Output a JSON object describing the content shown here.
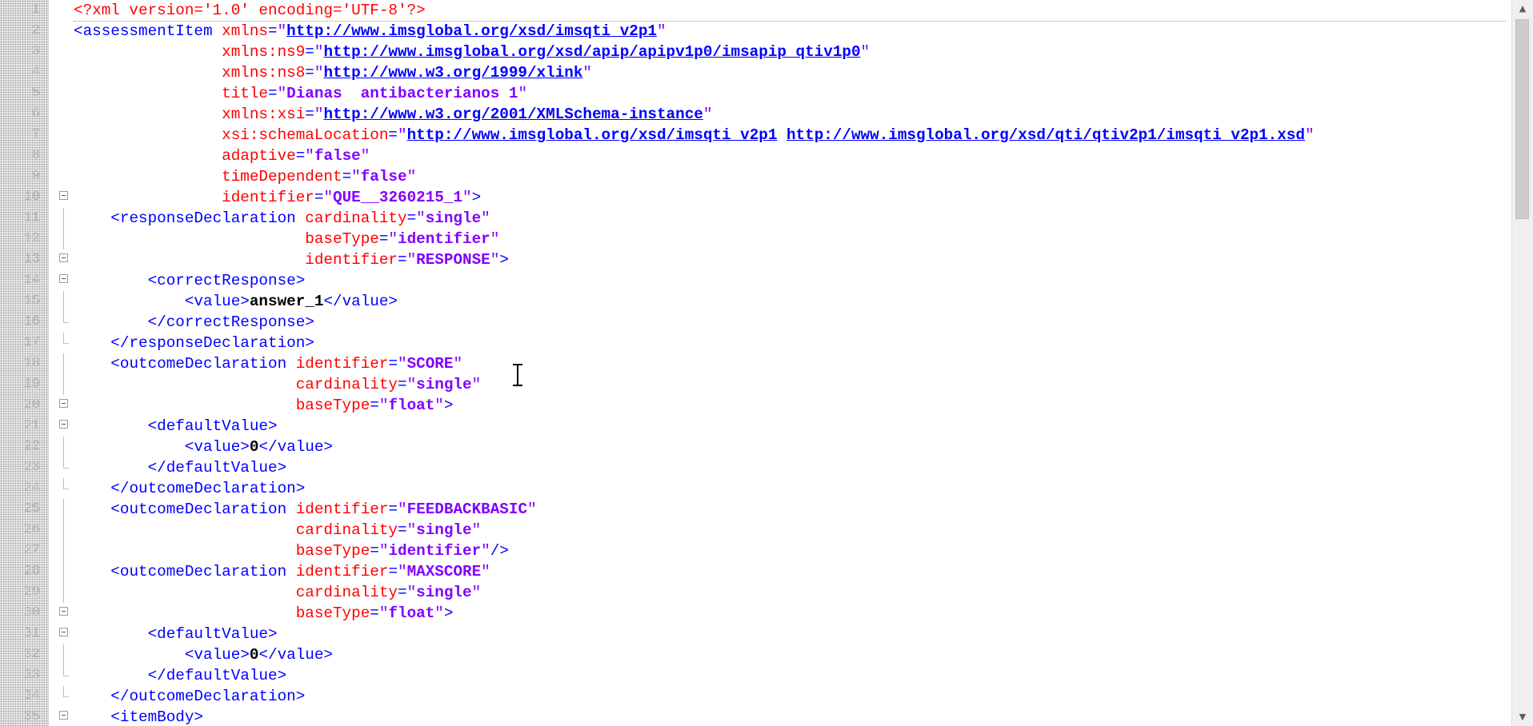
{
  "editor": {
    "lines": [
      {
        "n": "1",
        "tokens": [
          {
            "t": "pi",
            "s": "<?xml version='1.0' encoding='UTF-8'?>"
          }
        ]
      },
      {
        "n": "2",
        "tokens": [
          {
            "t": "tag",
            "s": "<assessmentItem "
          },
          {
            "t": "attr",
            "s": "xmlns"
          },
          {
            "t": "tag",
            "s": "="
          },
          {
            "t": "q",
            "s": "\""
          },
          {
            "t": "url",
            "s": "http://www.imsglobal.org/xsd/imsqti_v2p1"
          },
          {
            "t": "q",
            "s": "\""
          }
        ]
      },
      {
        "n": "3",
        "tokens": [
          {
            "t": "plain",
            "s": "                "
          },
          {
            "t": "attr",
            "s": "xmlns:ns9"
          },
          {
            "t": "tag",
            "s": "="
          },
          {
            "t": "q",
            "s": "\""
          },
          {
            "t": "url",
            "s": "http://www.imsglobal.org/xsd/apip/apipv1p0/imsapip_qtiv1p0"
          },
          {
            "t": "q",
            "s": "\""
          }
        ]
      },
      {
        "n": "4",
        "tokens": [
          {
            "t": "plain",
            "s": "                "
          },
          {
            "t": "attr",
            "s": "xmlns:ns8"
          },
          {
            "t": "tag",
            "s": "="
          },
          {
            "t": "q",
            "s": "\""
          },
          {
            "t": "url",
            "s": "http://www.w3.org/1999/xlink"
          },
          {
            "t": "q",
            "s": "\""
          }
        ]
      },
      {
        "n": "5",
        "tokens": [
          {
            "t": "plain",
            "s": "                "
          },
          {
            "t": "attr",
            "s": "title"
          },
          {
            "t": "tag",
            "s": "="
          },
          {
            "t": "q",
            "s": "\""
          },
          {
            "t": "val",
            "s": "Dianas  antibacterianos 1"
          },
          {
            "t": "q",
            "s": "\""
          }
        ]
      },
      {
        "n": "6",
        "tokens": [
          {
            "t": "plain",
            "s": "                "
          },
          {
            "t": "attr",
            "s": "xmlns:xsi"
          },
          {
            "t": "tag",
            "s": "="
          },
          {
            "t": "q",
            "s": "\""
          },
          {
            "t": "url",
            "s": "http://www.w3.org/2001/XMLSchema-instance"
          },
          {
            "t": "q",
            "s": "\""
          }
        ]
      },
      {
        "n": "7",
        "tokens": [
          {
            "t": "plain",
            "s": "                "
          },
          {
            "t": "attr",
            "s": "xsi:schemaLocation"
          },
          {
            "t": "tag",
            "s": "="
          },
          {
            "t": "q",
            "s": "\""
          },
          {
            "t": "url",
            "s": "http://www.imsglobal.org/xsd/imsqti_v2p1"
          },
          {
            "t": "plain",
            "s": " "
          },
          {
            "t": "url",
            "s": "http://www.imsglobal.org/xsd/qti/qtiv2p1/imsqti_v2p1.xsd"
          },
          {
            "t": "q",
            "s": "\""
          }
        ]
      },
      {
        "n": "8",
        "tokens": [
          {
            "t": "plain",
            "s": "                "
          },
          {
            "t": "attr",
            "s": "adaptive"
          },
          {
            "t": "tag",
            "s": "="
          },
          {
            "t": "q",
            "s": "\""
          },
          {
            "t": "val",
            "s": "false"
          },
          {
            "t": "q",
            "s": "\""
          }
        ]
      },
      {
        "n": "9",
        "tokens": [
          {
            "t": "plain",
            "s": "                "
          },
          {
            "t": "attr",
            "s": "timeDependent"
          },
          {
            "t": "tag",
            "s": "="
          },
          {
            "t": "q",
            "s": "\""
          },
          {
            "t": "val",
            "s": "false"
          },
          {
            "t": "q",
            "s": "\""
          }
        ]
      },
      {
        "n": "10",
        "tokens": [
          {
            "t": "plain",
            "s": "                "
          },
          {
            "t": "attr",
            "s": "identifier"
          },
          {
            "t": "tag",
            "s": "="
          },
          {
            "t": "q",
            "s": "\""
          },
          {
            "t": "val",
            "s": "QUE__3260215_1"
          },
          {
            "t": "q",
            "s": "\""
          },
          {
            "t": "tag",
            "s": ">"
          }
        ]
      },
      {
        "n": "11",
        "tokens": [
          {
            "t": "plain",
            "s": "    "
          },
          {
            "t": "tag",
            "s": "<responseDeclaration "
          },
          {
            "t": "attr",
            "s": "cardinality"
          },
          {
            "t": "tag",
            "s": "="
          },
          {
            "t": "q",
            "s": "\""
          },
          {
            "t": "val",
            "s": "single"
          },
          {
            "t": "q",
            "s": "\""
          }
        ]
      },
      {
        "n": "12",
        "tokens": [
          {
            "t": "plain",
            "s": "                         "
          },
          {
            "t": "attr",
            "s": "baseType"
          },
          {
            "t": "tag",
            "s": "="
          },
          {
            "t": "q",
            "s": "\""
          },
          {
            "t": "val",
            "s": "identifier"
          },
          {
            "t": "q",
            "s": "\""
          }
        ]
      },
      {
        "n": "13",
        "tokens": [
          {
            "t": "plain",
            "s": "                         "
          },
          {
            "t": "attr",
            "s": "identifier"
          },
          {
            "t": "tag",
            "s": "="
          },
          {
            "t": "q",
            "s": "\""
          },
          {
            "t": "val",
            "s": "RESPONSE"
          },
          {
            "t": "q",
            "s": "\""
          },
          {
            "t": "tag",
            "s": ">"
          }
        ]
      },
      {
        "n": "14",
        "tokens": [
          {
            "t": "plain",
            "s": "        "
          },
          {
            "t": "tag",
            "s": "<correctResponse>"
          }
        ]
      },
      {
        "n": "15",
        "tokens": [
          {
            "t": "plain",
            "s": "            "
          },
          {
            "t": "tag",
            "s": "<value>"
          },
          {
            "t": "text",
            "s": "answer_1"
          },
          {
            "t": "tag",
            "s": "</value>"
          }
        ]
      },
      {
        "n": "16",
        "tokens": [
          {
            "t": "plain",
            "s": "        "
          },
          {
            "t": "tag",
            "s": "</correctResponse>"
          }
        ]
      },
      {
        "n": "17",
        "tokens": [
          {
            "t": "plain",
            "s": "    "
          },
          {
            "t": "tag",
            "s": "</responseDeclaration>"
          }
        ]
      },
      {
        "n": "18",
        "tokens": [
          {
            "t": "plain",
            "s": "    "
          },
          {
            "t": "tag",
            "s": "<outcomeDeclaration "
          },
          {
            "t": "attr",
            "s": "identifier"
          },
          {
            "t": "tag",
            "s": "="
          },
          {
            "t": "q",
            "s": "\""
          },
          {
            "t": "val",
            "s": "SCORE"
          },
          {
            "t": "q",
            "s": "\""
          }
        ]
      },
      {
        "n": "19",
        "tokens": [
          {
            "t": "plain",
            "s": "                        "
          },
          {
            "t": "attr",
            "s": "cardinality"
          },
          {
            "t": "tag",
            "s": "="
          },
          {
            "t": "q",
            "s": "\""
          },
          {
            "t": "val",
            "s": "single"
          },
          {
            "t": "q",
            "s": "\""
          }
        ]
      },
      {
        "n": "20",
        "tokens": [
          {
            "t": "plain",
            "s": "                        "
          },
          {
            "t": "attr",
            "s": "baseType"
          },
          {
            "t": "tag",
            "s": "="
          },
          {
            "t": "q",
            "s": "\""
          },
          {
            "t": "val",
            "s": "float"
          },
          {
            "t": "q",
            "s": "\""
          },
          {
            "t": "tag",
            "s": ">"
          }
        ]
      },
      {
        "n": "21",
        "tokens": [
          {
            "t": "plain",
            "s": "        "
          },
          {
            "t": "tag",
            "s": "<defaultValue>"
          }
        ]
      },
      {
        "n": "22",
        "tokens": [
          {
            "t": "plain",
            "s": "            "
          },
          {
            "t": "tag",
            "s": "<value>"
          },
          {
            "t": "text",
            "s": "0"
          },
          {
            "t": "tag",
            "s": "</value>"
          }
        ]
      },
      {
        "n": "23",
        "tokens": [
          {
            "t": "plain",
            "s": "        "
          },
          {
            "t": "tag",
            "s": "</defaultValue>"
          }
        ]
      },
      {
        "n": "24",
        "tokens": [
          {
            "t": "plain",
            "s": "    "
          },
          {
            "t": "tag",
            "s": "</outcomeDeclaration>"
          }
        ]
      },
      {
        "n": "25",
        "tokens": [
          {
            "t": "plain",
            "s": "    "
          },
          {
            "t": "tag",
            "s": "<outcomeDeclaration "
          },
          {
            "t": "attr",
            "s": "identifier"
          },
          {
            "t": "tag",
            "s": "="
          },
          {
            "t": "q",
            "s": "\""
          },
          {
            "t": "val",
            "s": "FEEDBACKBASIC"
          },
          {
            "t": "q",
            "s": "\""
          }
        ]
      },
      {
        "n": "26",
        "tokens": [
          {
            "t": "plain",
            "s": "                        "
          },
          {
            "t": "attr",
            "s": "cardinality"
          },
          {
            "t": "tag",
            "s": "="
          },
          {
            "t": "q",
            "s": "\""
          },
          {
            "t": "val",
            "s": "single"
          },
          {
            "t": "q",
            "s": "\""
          }
        ]
      },
      {
        "n": "27",
        "tokens": [
          {
            "t": "plain",
            "s": "                        "
          },
          {
            "t": "attr",
            "s": "baseType"
          },
          {
            "t": "tag",
            "s": "="
          },
          {
            "t": "q",
            "s": "\""
          },
          {
            "t": "val",
            "s": "identifier"
          },
          {
            "t": "q",
            "s": "\""
          },
          {
            "t": "tag",
            "s": "/>"
          }
        ]
      },
      {
        "n": "28",
        "tokens": [
          {
            "t": "plain",
            "s": "    "
          },
          {
            "t": "tag",
            "s": "<outcomeDeclaration "
          },
          {
            "t": "attr",
            "s": "identifier"
          },
          {
            "t": "tag",
            "s": "="
          },
          {
            "t": "q",
            "s": "\""
          },
          {
            "t": "val",
            "s": "MAXSCORE"
          },
          {
            "t": "q",
            "s": "\""
          }
        ]
      },
      {
        "n": "29",
        "tokens": [
          {
            "t": "plain",
            "s": "                        "
          },
          {
            "t": "attr",
            "s": "cardinality"
          },
          {
            "t": "tag",
            "s": "="
          },
          {
            "t": "q",
            "s": "\""
          },
          {
            "t": "val",
            "s": "single"
          },
          {
            "t": "q",
            "s": "\""
          }
        ]
      },
      {
        "n": "30",
        "tokens": [
          {
            "t": "plain",
            "s": "                        "
          },
          {
            "t": "attr",
            "s": "baseType"
          },
          {
            "t": "tag",
            "s": "="
          },
          {
            "t": "q",
            "s": "\""
          },
          {
            "t": "val",
            "s": "float"
          },
          {
            "t": "q",
            "s": "\""
          },
          {
            "t": "tag",
            "s": ">"
          }
        ]
      },
      {
        "n": "31",
        "tokens": [
          {
            "t": "plain",
            "s": "        "
          },
          {
            "t": "tag",
            "s": "<defaultValue>"
          }
        ]
      },
      {
        "n": "32",
        "tokens": [
          {
            "t": "plain",
            "s": "            "
          },
          {
            "t": "tag",
            "s": "<value>"
          },
          {
            "t": "text",
            "s": "0"
          },
          {
            "t": "tag",
            "s": "</value>"
          }
        ]
      },
      {
        "n": "33",
        "tokens": [
          {
            "t": "plain",
            "s": "        "
          },
          {
            "t": "tag",
            "s": "</defaultValue>"
          }
        ]
      },
      {
        "n": "34",
        "tokens": [
          {
            "t": "plain",
            "s": "    "
          },
          {
            "t": "tag",
            "s": "</outcomeDeclaration>"
          }
        ]
      },
      {
        "n": "35",
        "tokens": [
          {
            "t": "plain",
            "s": "    "
          },
          {
            "t": "tag",
            "s": "<itemBody>"
          }
        ]
      }
    ],
    "folds": {
      "open": [
        "10",
        "13",
        "14",
        "20",
        "21",
        "30",
        "31",
        "35"
      ],
      "end": [
        "16",
        "17",
        "23",
        "24",
        "33",
        "34"
      ],
      "inner": [
        "11",
        "12",
        "15",
        "18",
        "19",
        "22",
        "25",
        "26",
        "27",
        "28",
        "29",
        "32"
      ]
    },
    "current_line": "1"
  },
  "colors": {
    "processing_instruction": "#ff0000",
    "tag": "#0000ff",
    "attribute": "#ff0000",
    "value": "#8000ff",
    "url": "#0000ff"
  },
  "scrollbar": {
    "up_icon": "arrow-up-icon",
    "down_icon": "arrow-down-icon"
  }
}
